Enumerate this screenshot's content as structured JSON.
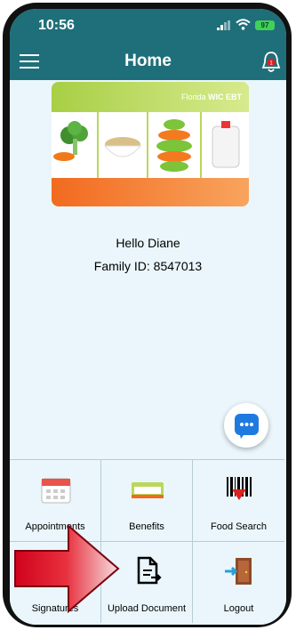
{
  "status_bar": {
    "time": "10:56",
    "battery": "97"
  },
  "header": {
    "title": "Home"
  },
  "card": {
    "brand_prefix": "Florida ",
    "brand_bold": "WIC EBT"
  },
  "user": {
    "greeting": "Hello Diane",
    "family_id": "Family ID: 8547013"
  },
  "notifications": {
    "badge": "1"
  },
  "menu_tiles": [
    {
      "label": "Appointments"
    },
    {
      "label": "Benefits"
    },
    {
      "label": "Food Search"
    },
    {
      "label": "Signatures"
    },
    {
      "label": "Upload Document"
    },
    {
      "label": "Logout"
    }
  ],
  "colors": {
    "header": "#1f6f7a",
    "background": "#eaf6fb",
    "chat": "#1f7ae0",
    "arrow": "#d0021b"
  }
}
